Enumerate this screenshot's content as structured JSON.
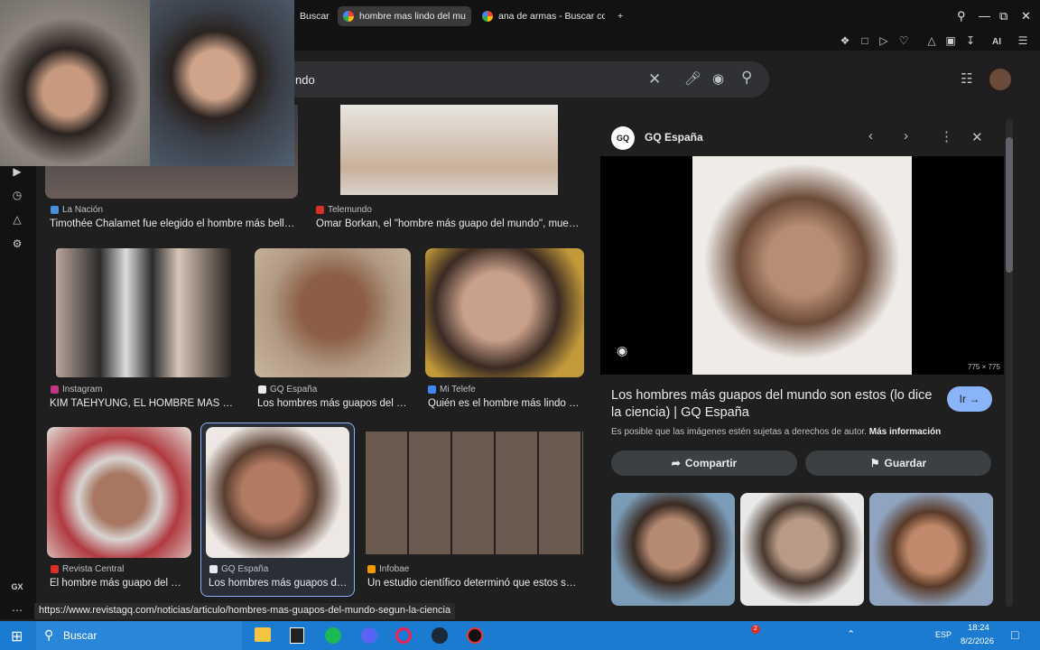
{
  "browser": {
    "tabs": [
      {
        "label": "Buscar",
        "active": false
      },
      {
        "label": "hombre mas lindo del mu",
        "active": true
      },
      {
        "label": "ana de armas - Buscar co",
        "active": false
      }
    ],
    "new_tab": "+"
  },
  "search": {
    "query_visible": "ndo"
  },
  "results": [
    {
      "source": "La Nación",
      "caption": "Timothée Chalamet fue elegido el hombre más bell…",
      "fav": "#4a90d9"
    },
    {
      "source": "Telemundo",
      "caption": "Omar Borkan, el \"hombre más guapo del mundo\", mue…",
      "fav": "#d93025"
    },
    {
      "source": "Instagram",
      "caption": "KIM TAEHYUNG, EL HOMBRE MÁS …",
      "fav": "#c13584"
    },
    {
      "source": "GQ España",
      "caption": "Los hombres más guapos del …",
      "fav": "#e8eaed"
    },
    {
      "source": "Mi Telefe",
      "caption": "Quién es el hombre más lindo …",
      "fav": "#4285f4"
    },
    {
      "source": "Revista Central",
      "caption": "El hombre más guapo del …",
      "fav": "#d93025"
    },
    {
      "source": "GQ España",
      "caption": "Los hombres más guapos d…",
      "fav": "#e8eaed"
    },
    {
      "source": "Infobae",
      "caption": "Un estudio científico determinó que estos s…",
      "fav": "#f29900"
    }
  ],
  "panel": {
    "source": "GQ España",
    "dimensions": "775 × 775",
    "title": "Los hombres más guapos del mundo son estos (lo dice la ciencia) | GQ España",
    "copyright": "Es posible que las imágenes estén sujetas a derechos de autor.",
    "more_info": "Más información",
    "go_label": "Ir",
    "share_label": "Compartir",
    "save_label": "Guardar"
  },
  "status_url": "https://www.revistagq.com/noticias/articulo/hombres-mas-guapos-del-mundo-segun-la-ciencia",
  "sidebar": {
    "gx_label": "GX"
  },
  "taskbar": {
    "search_label": "Buscar",
    "time": "18:24",
    "date": "8/2/2026",
    "lang": "ESP",
    "badge": "2"
  },
  "toolbar": {
    "ai_label": "AI"
  }
}
